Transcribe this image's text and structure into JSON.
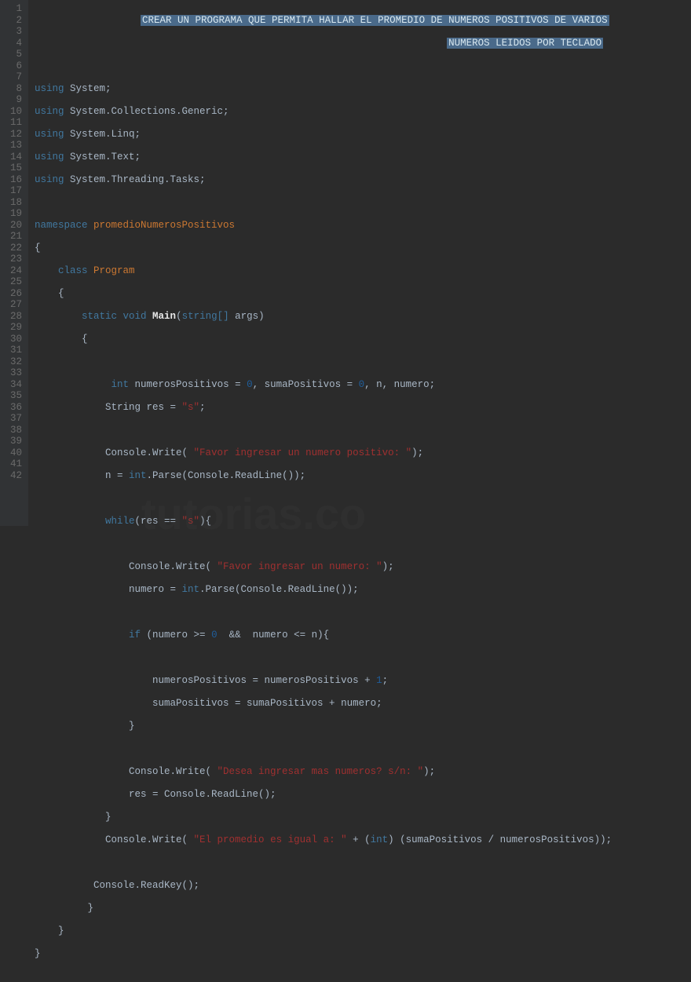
{
  "watermark": "tutorias.co",
  "comment1": "CREAR UN PROGRAMA QUE PERMITA HALLAR EL PROMEDIO DE NUMEROS POSITIVOS DE VARIOS",
  "comment2": "NUMEROS LEIDOS POR TECLADO",
  "lineNumbers": [
    "1",
    "2",
    "3",
    "4",
    "5",
    "6",
    "7",
    "8",
    "9",
    "10",
    "11",
    "12",
    "13",
    "14",
    "15",
    "16",
    "17",
    "18",
    "19",
    "20",
    "21",
    "22",
    "23",
    "24",
    "25",
    "26",
    "27",
    "28",
    "29",
    "30",
    "31",
    "32",
    "33",
    "34",
    "35",
    "36",
    "37",
    "38",
    "39",
    "40",
    "41",
    "42"
  ],
  "code": {
    "using1_kw": "using",
    "using1_ns": " System;",
    "using2_kw": "using",
    "using2_ns": " System.Collections.Generic;",
    "using3_kw": "using",
    "using3_ns": " System.Linq;",
    "using4_kw": "using",
    "using4_ns": " System.Text;",
    "using5_kw": "using",
    "using5_ns": " System.Threading.Tasks;",
    "ns_kw": "namespace",
    "ns_name": " promedioNumerosPositivos",
    "obrace": "{",
    "class_kw": "    class ",
    "class_name": "Program",
    "class_ob": "    {",
    "main_static": "        static ",
    "main_void": "void",
    "main_name": " Main",
    "main_paren_o": "(",
    "main_argtype": "string[]",
    "main_args": " args)",
    "main_ob": "        {",
    "l16": "",
    "l17_a": "             ",
    "l17_int": "int",
    "l17_b": " numerosPositivos = ",
    "l17_z1": "0",
    "l17_c": ", sumaPositivos = ",
    "l17_z2": "0",
    "l17_d": ", n, numero;",
    "l18_a": "            String res = ",
    "l18_s": "\"s\"",
    "l18_b": ";",
    "l20_a": "            Console.Write( ",
    "l20_s": "\"Favor ingresar un numero positivo: \"",
    "l20_b": ");",
    "l21_a": "            n = ",
    "l21_int": "int",
    "l21_b": ".Parse(Console.ReadLine());",
    "l23_a": "            ",
    "l23_while": "while",
    "l23_b": "(res == ",
    "l23_s": "\"s\"",
    "l23_c": "){",
    "l25_a": "                Console.Write( ",
    "l25_s": "\"Favor ingresar un numero: \"",
    "l25_b": ");",
    "l26_a": "                numero = ",
    "l26_int": "int",
    "l26_b": ".Parse(Console.ReadLine());",
    "l28_a": "                ",
    "l28_if": "if",
    "l28_b": " (numero >= ",
    "l28_z": "0",
    "l28_c": "  &&  numero <= n){",
    "l30_a": "                    numerosPositivos = numerosPositivos + ",
    "l30_one": "1",
    "l30_b": ";",
    "l31": "                    sumaPositivos = sumaPositivos + numero;",
    "l32": "                }",
    "l34_a": "                Console.Write( ",
    "l34_s": "\"Desea ingresar mas numeros? s/n: \"",
    "l34_b": ");",
    "l35": "                res = Console.ReadLine();",
    "l36": "            }",
    "l37_a": "            Console.Write( ",
    "l37_s": "\"El promedio es igual a: \"",
    "l37_b": " + (",
    "l37_int": "int",
    "l37_c": ") (sumaPositivos / numerosPositivos));",
    "l39": "          Console.ReadKey();",
    "l40": "         }",
    "l41": "    }",
    "l42": "}"
  }
}
